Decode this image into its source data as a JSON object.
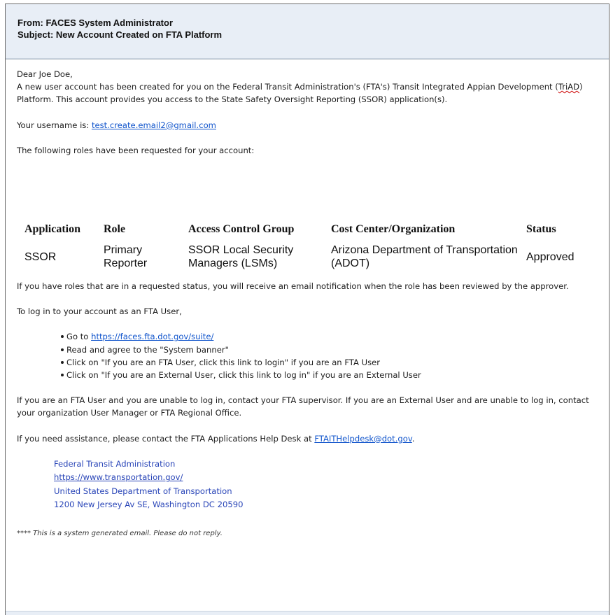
{
  "email": {
    "from": "From: FACES System Administrator",
    "subject": "Subject: New Account Created on FTA Platform"
  },
  "body": {
    "greeting": "Dear Joe Doe,",
    "intro_part1": "A new user account has been created for you on the Federal Transit Administration's (FTA's) Transit Integrated Appian Development (",
    "intro_triad": "TriAD",
    "intro_part2": ") Platform. This account provides you access to the State Safety Oversight Reporting (SSOR) application(s).",
    "username_label": "Your username is: ",
    "username_value": "test.create.email2@gmail.com",
    "roles_intro": "The following roles have been requested for your account:",
    "table": {
      "headers": [
        "Application",
        "Role",
        "Access Control Group",
        "Cost Center/Organization",
        "Status"
      ],
      "rows": [
        {
          "application": "SSOR",
          "role": "Primary Reporter",
          "group": "SSOR Local Security Managers (LSMs)",
          "organization": "Arizona Department of Transportation (ADOT)",
          "status": "Approved"
        }
      ]
    },
    "requested_note": "If you have roles that are in a requested status, you will receive an email notification when the role has been reviewed by the approver.",
    "login_intro": "To log in to your account as an FTA User,",
    "steps": {
      "goto_prefix": "Go to ",
      "goto_link": "https://faces.fta.dot.gov/suite/",
      "banner": "Read and agree to the \"System banner\"",
      "fta_user": "Click on \"If you are an FTA User, click this link to login\" if you are an FTA User",
      "external_user": "Click on \"If you are an External User, click this link to log in\" if you are an External User"
    },
    "unable_login": "If you are an FTA User and you are unable to log in, contact your FTA supervisor. If you are an External User and are unable to log in, contact your organization User Manager or FTA Regional Office.",
    "assistance_prefix": "If you need assistance, please contact the FTA Applications Help Desk at ",
    "assistance_email": "FTAITHelpdesk@dot.gov",
    "assistance_suffix": ".",
    "signature": {
      "org": "Federal Transit Administration",
      "url": "https://www.transportation.gov/",
      "dept": "United States Department of Transportation",
      "address": "1200 New Jersey Av SE, Washington DC 20590"
    },
    "footer": "**** This is a system generated email. Please do not reply."
  },
  "colors": {
    "header_bg": "#e8eef6",
    "link": "#1155cc",
    "signature": "#2a46b8"
  }
}
